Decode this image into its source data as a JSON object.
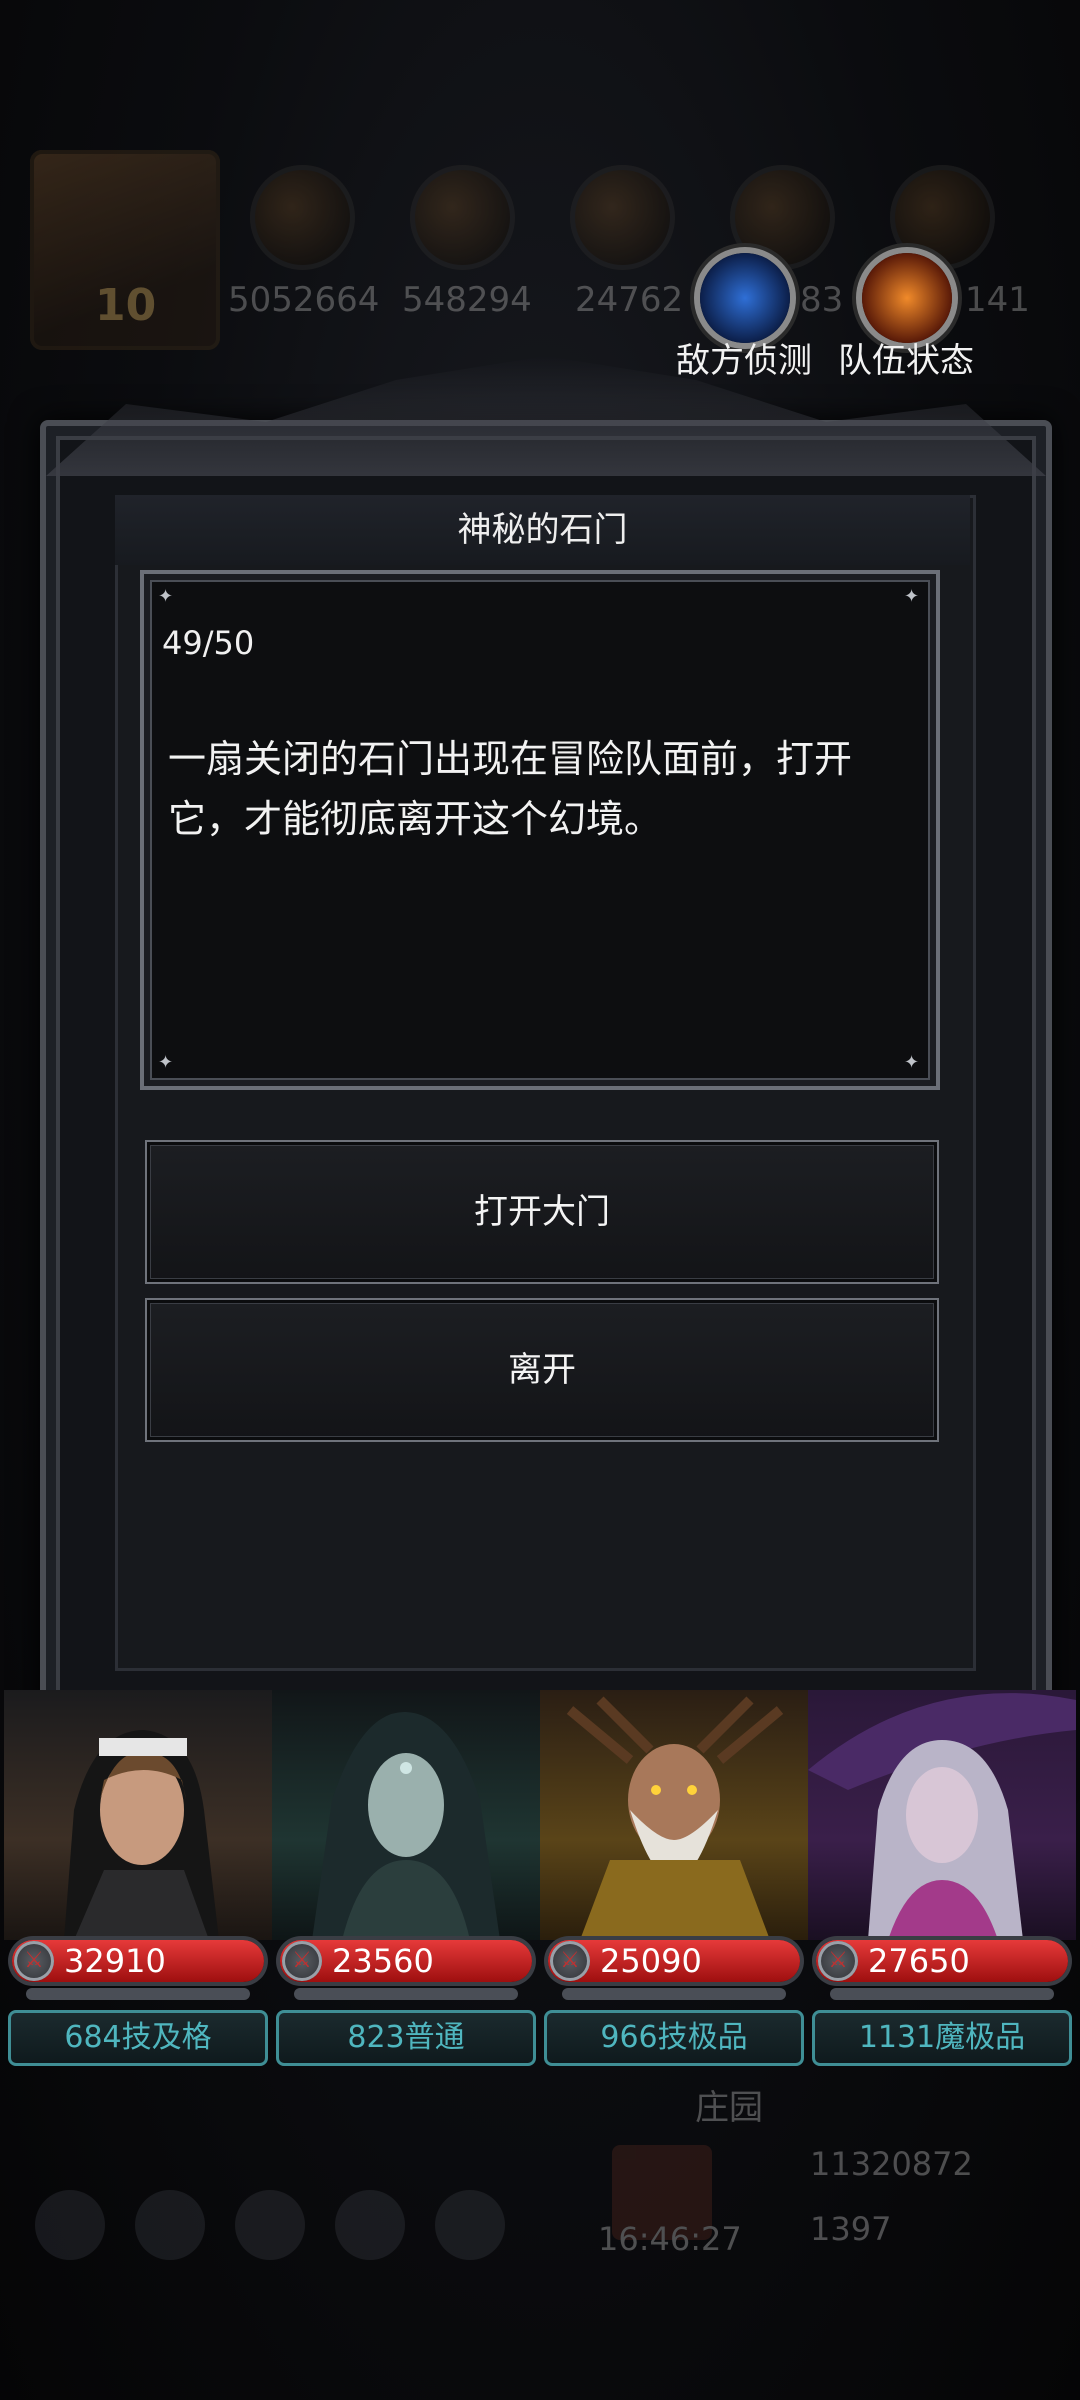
{
  "hud": {
    "level": "10",
    "resources": [
      "5052664",
      "548294",
      "24762",
      "83",
      "141"
    ],
    "skills": [
      {
        "label": "敌方侦测",
        "icon": "radar-orb-icon"
      },
      {
        "label": "队伍状态",
        "icon": "team-status-icon"
      }
    ]
  },
  "dialog": {
    "title": "神秘的石门",
    "counter": "49/50",
    "story": "一扇关闭的石门出现在冒险队面前，打开它，才能彻底离开这个幻境。",
    "choices": [
      "打开大门",
      "离开"
    ]
  },
  "heroes": [
    {
      "hp": "32910",
      "grade": "684技及格",
      "color": "#3c2f25"
    },
    {
      "hp": "23560",
      "grade": "823普通",
      "color": "#1f3532"
    },
    {
      "hp": "25090",
      "grade": "966技极品",
      "color": "#5a4418"
    },
    {
      "hp": "27650",
      "grade": "1131魔极品",
      "color": "#3a1f4a"
    }
  ],
  "bottom": {
    "manor": "庄园",
    "gold": "11320872",
    "gems": "1397",
    "clock": "16:46:27"
  },
  "colors": {
    "hp_red": "#c81e1e",
    "grade_teal": "#4fb6bf",
    "frame_grey": "#4a4d54"
  }
}
